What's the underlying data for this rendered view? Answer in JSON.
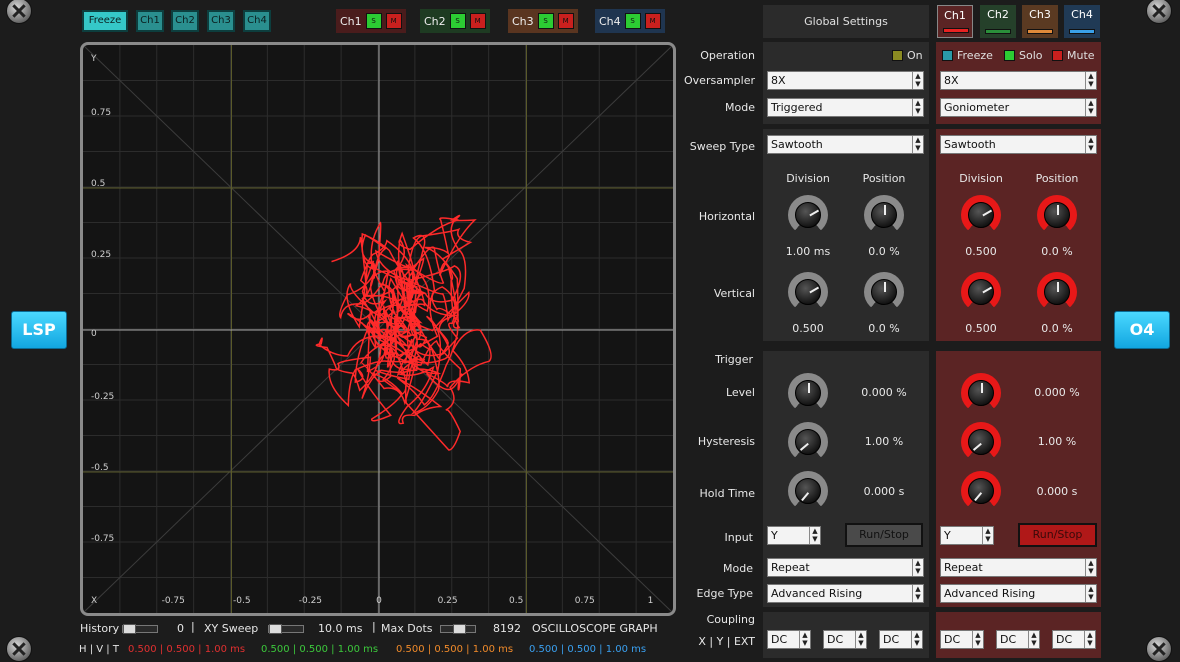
{
  "toolbar": {
    "freeze": "Freeze",
    "ch1": "Ch1",
    "ch2": "Ch2",
    "ch3": "Ch3",
    "ch4": "Ch4",
    "groups": [
      {
        "label": "Ch1",
        "color": "#4a1c1c"
      },
      {
        "label": "Ch2",
        "color": "#1e3b22"
      },
      {
        "label": "Ch3",
        "color": "#5a3520"
      },
      {
        "label": "Ch4",
        "color": "#1f3550"
      }
    ],
    "solo_glyph": "S",
    "mute_glyph": "M"
  },
  "graph": {
    "y_axis_name": "Y",
    "x_axis_name": "X",
    "y_ticks": [
      "0.75",
      "0.5",
      "0.25",
      "0",
      "-0.25",
      "-0.5",
      "-0.75"
    ],
    "x_ticks": [
      "-0.75",
      "-0.5",
      "-0.25",
      "0",
      "0.25",
      "0.5",
      "0.75",
      "1"
    ],
    "trace_color": "#ff2a2a"
  },
  "side": {
    "left": "LSP",
    "right": "O4"
  },
  "status": {
    "history_label": "History",
    "history_value": "0",
    "xy_sweep_label": "XY Sweep",
    "xy_sweep_value": "10.0 ms",
    "max_dots_label": "Max Dots",
    "max_dots_value": "8192",
    "title": "OSCILLOSCOPE GRAPH",
    "hvt_label": "H | V | T",
    "ch1_hvt": "0.500 | 0.500 | 1.00 ms",
    "ch2_hvt": "0.500 | 0.500 | 1.00 ms",
    "ch3_hvt": "0.500 | 0.500 | 1.00 ms",
    "ch4_hvt": "0.500 | 0.500 | 1.00 ms"
  },
  "global": {
    "header": "Global Settings",
    "operation_label": "Operation",
    "on_label": "On",
    "oversampler_label": "Oversampler",
    "oversampler": "8X",
    "mode_label": "Mode",
    "mode": "Triggered",
    "sweep_type_label": "Sweep Type",
    "sweep_type": "Sawtooth",
    "division_label": "Division",
    "position_label": "Position",
    "horizontal_label": "Horizontal",
    "h_division": "1.00 ms",
    "h_position": "0.0 %",
    "vertical_label": "Vertical",
    "v_division": "0.500",
    "v_position": "0.0 %",
    "trigger_label": "Trigger",
    "level_label": "Level",
    "level": "0.000 %",
    "hysteresis_label": "Hysteresis",
    "hysteresis": "1.00 %",
    "hold_time_label": "Hold Time",
    "hold_time": "0.000 s",
    "input_label": "Input",
    "input": "Y",
    "run_stop": "Run/Stop",
    "trig_mode_label": "Mode",
    "trig_mode": "Repeat",
    "edge_type_label": "Edge Type",
    "edge_type": "Advanced Rising",
    "coupling_label": "Coupling",
    "coupling_sub": "X | Y | EXT",
    "coupling": [
      "DC",
      "DC",
      "DC"
    ]
  },
  "channel": {
    "tabs": [
      {
        "label": "Ch1",
        "bg": "#5b2424",
        "bar": "#e82222"
      },
      {
        "label": "Ch2",
        "bg": "#25402a",
        "bar": "#2a8f3a"
      },
      {
        "label": "Ch3",
        "bg": "#5a3a22",
        "bar": "#e08a3a"
      },
      {
        "label": "Ch4",
        "bg": "#203a55",
        "bar": "#3aa0e8"
      }
    ],
    "freeze": "Freeze",
    "solo": "Solo",
    "mute": "Mute",
    "oversampler": "8X",
    "mode": "Goniometer",
    "sweep_type": "Sawtooth",
    "division_label": "Division",
    "position_label": "Position",
    "h_division": "0.500",
    "h_position": "0.0 %",
    "v_division": "0.500",
    "v_position": "0.0 %",
    "level": "0.000 %",
    "hysteresis": "1.00 %",
    "hold_time": "0.000 s",
    "input": "Y",
    "run_stop": "Run/Stop",
    "trig_mode": "Repeat",
    "edge_type": "Advanced Rising",
    "coupling": [
      "DC",
      "DC",
      "DC"
    ]
  }
}
